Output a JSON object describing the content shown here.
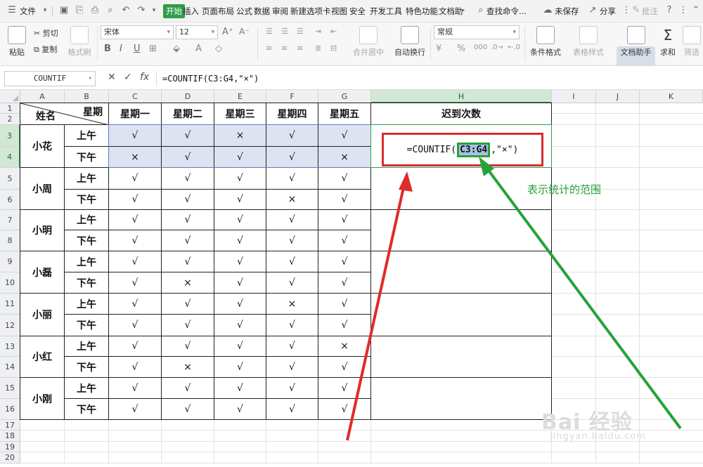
{
  "menubar": {
    "file_label": "文件",
    "tabs": [
      "开始",
      "插入",
      "页面布局",
      "公式",
      "数据",
      "审阅",
      "新建选项卡",
      "视图",
      "安全",
      "开发工具",
      "特色功能",
      "文档助"
    ],
    "active_tab": "开始",
    "search_label": "查找命令...",
    "unsaved_label": "未保存",
    "share_label": "分享",
    "comment_label": "批注"
  },
  "ribbon": {
    "paste_label": "粘贴",
    "cut_label": "剪切",
    "copy_label": "复制",
    "format_painter_label": "格式刷",
    "font_name": "宋体",
    "font_size": "12",
    "merge_label": "合并居中",
    "wrap_label": "自动换行",
    "number_format": "常规",
    "cond_format_label": "条件格式",
    "table_style_label": "表格样式",
    "doc_assistant_label": "文档助手",
    "sum_label": "求和",
    "filter_label": "筛选",
    "bold_glyph": "B",
    "italic_glyph": "I",
    "underline_glyph": "U",
    "percent_glyph": "%"
  },
  "formula_bar": {
    "name_box": "COUNTIF",
    "cancel_glyph": "✕",
    "confirm_glyph": "✓",
    "fx_label": "fx",
    "formula": "=COUNTIF(C3:G4,\"×\")"
  },
  "columns": [
    "A",
    "B",
    "C",
    "D",
    "E",
    "F",
    "G",
    "H",
    "I",
    "J",
    "K"
  ],
  "rows": [
    "1",
    "2",
    "3",
    "4",
    "5",
    "6",
    "7",
    "8",
    "9",
    "10",
    "11",
    "12",
    "13",
    "14",
    "15",
    "16",
    "17",
    "18",
    "19",
    "20"
  ],
  "table": {
    "header_week": "星期",
    "header_name": "姓名",
    "days": [
      "星期一",
      "星期二",
      "星期三",
      "星期四",
      "星期五"
    ],
    "late_count_header": "迟到次数",
    "people": [
      {
        "name": "小花",
        "am": [
          "√",
          "√",
          "×",
          "√",
          "√"
        ],
        "pm": [
          "×",
          "√",
          "√",
          "√",
          "×"
        ]
      },
      {
        "name": "小周",
        "am": [
          "√",
          "√",
          "√",
          "√",
          "√"
        ],
        "pm": [
          "√",
          "√",
          "√",
          "×",
          "√"
        ]
      },
      {
        "name": "小明",
        "am": [
          "√",
          "√",
          "√",
          "√",
          "√"
        ],
        "pm": [
          "√",
          "√",
          "√",
          "√",
          "√"
        ]
      },
      {
        "name": "小磊",
        "am": [
          "√",
          "√",
          "√",
          "√",
          "√"
        ],
        "pm": [
          "√",
          "×",
          "√",
          "√",
          "√"
        ]
      },
      {
        "name": "小丽",
        "am": [
          "√",
          "√",
          "√",
          "×",
          "√"
        ],
        "pm": [
          "√",
          "√",
          "√",
          "√",
          "√"
        ]
      },
      {
        "name": "小红",
        "am": [
          "√",
          "√",
          "√",
          "√",
          "×"
        ],
        "pm": [
          "√",
          "×",
          "√",
          "√",
          "√"
        ]
      },
      {
        "name": "小刚",
        "am": [
          "√",
          "√",
          "√",
          "√",
          "√"
        ],
        "pm": [
          "√",
          "√",
          "√",
          "√",
          "√"
        ]
      }
    ],
    "am_label": "上午",
    "pm_label": "下午"
  },
  "formula_overlay": {
    "prefix": "=COUNTIF(",
    "range_ref": "C3:G4",
    "suffix": ",\"×\")"
  },
  "annotation_text": "表示统计的范围",
  "watermark": {
    "main": "Bai 经验",
    "sub": "jingyan.baidu.com"
  },
  "colors": {
    "accent_green": "#2e9d4b",
    "annotation_green": "#25a338",
    "arrow_red": "#e02b2b",
    "selection_fill": "#dde3f0"
  }
}
